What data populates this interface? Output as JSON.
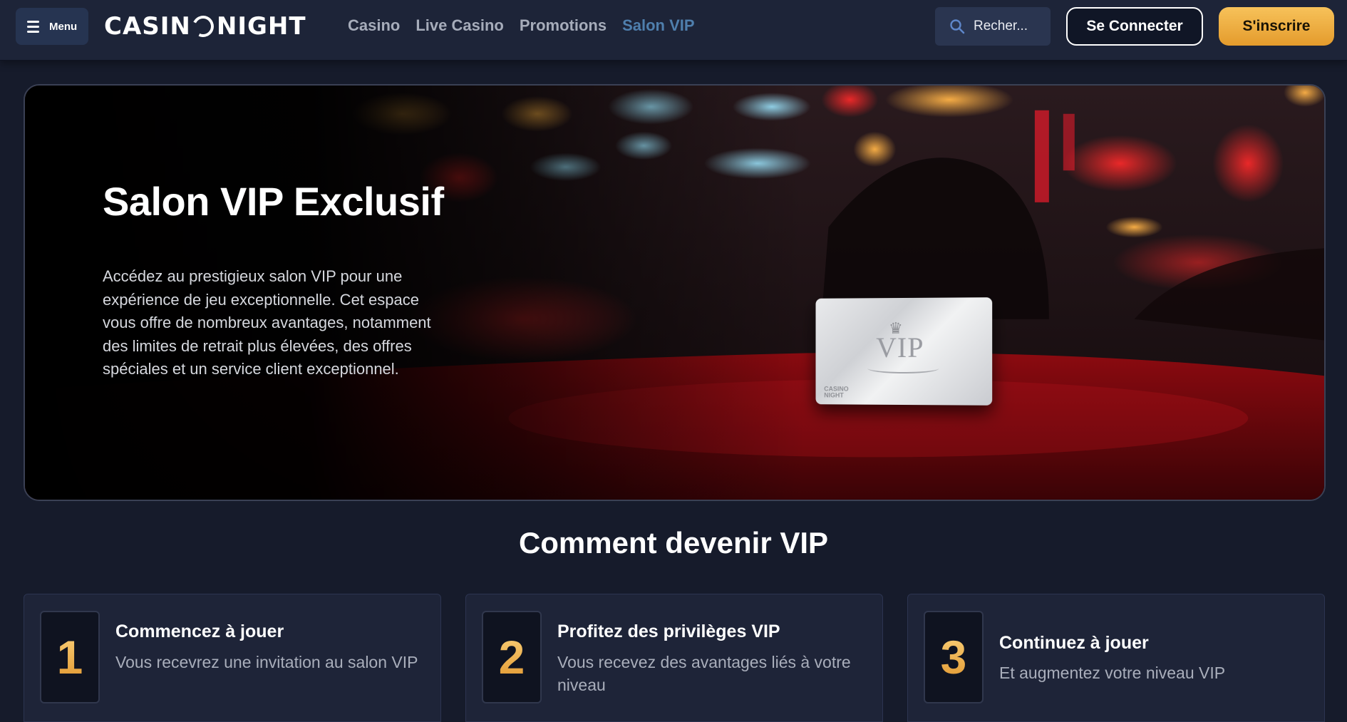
{
  "header": {
    "menu_label": "Menu",
    "logo_left": "CASIN",
    "logo_right": "NIGHT",
    "nav": [
      {
        "label": "Casino",
        "active": false
      },
      {
        "label": "Live Casino",
        "active": false
      },
      {
        "label": "Promotions",
        "active": false
      },
      {
        "label": "Salon VIP",
        "active": true
      }
    ],
    "search_placeholder": "Recher...",
    "login_label": "Se Connecter",
    "signup_label": "S'inscrire"
  },
  "hero": {
    "title": "Salon VIP Exclusif",
    "description": "Accédez au prestigieux salon VIP pour une expérience de jeu exceptionnelle. Cet espace vous offre de nombreux avantages, notamment des limites de retrait plus élevées, des offres spéciales et un service client exceptionnel."
  },
  "vip_card": {
    "text": "VIP",
    "mini_logo_line1": "CASINO",
    "mini_logo_line2": "NIGHT"
  },
  "how_to": {
    "title": "Comment devenir VIP",
    "steps": [
      {
        "number": "1",
        "title": "Commencez à jouer",
        "description": "Vous recevrez une invitation au salon VIP"
      },
      {
        "number": "2",
        "title": "Profitez des privilèges VIP",
        "description": "Vous recevez des avantages liés à votre niveau"
      },
      {
        "number": "3",
        "title": "Continuez à jouer",
        "description": "Et augmentez votre niveau VIP"
      }
    ]
  },
  "colors": {
    "background": "#161b2b",
    "header": "#1d2438",
    "nav_active": "#4f7fad",
    "gold": "#f0b445",
    "card": "#1e2438"
  }
}
